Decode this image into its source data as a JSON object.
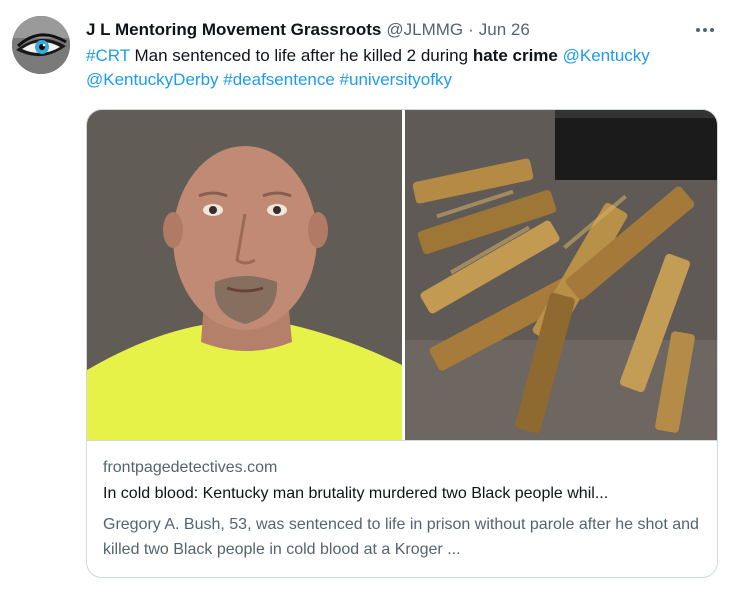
{
  "tweet": {
    "author": {
      "display_name": "J L Mentoring Movement Grassroots",
      "handle": "@JLMMG",
      "separator": "·",
      "date": "Jun 26"
    },
    "text": {
      "hashtag_crt": "#CRT",
      "body_part1": " Man sentenced to life after he killed 2 during ",
      "bold_phrase": "hate crime",
      "mention_kentucky": "@Kentucky",
      "mention_derby": "@KentuckyDerby",
      "hashtag_deaf": "#deafsentence",
      "hashtag_uky": "#universityofky"
    },
    "card": {
      "domain": "frontpagedetectives.com",
      "title": "In cold blood: Kentucky man brutality murdered two Black people whil...",
      "description": "Gregory A. Bush, 53, was sentenced to life in prison without parole after he shot and killed two Black people in cold blood at a Kroger ..."
    }
  },
  "icons": {
    "more": "more-horizontal-icon"
  },
  "colors": {
    "link": "#1d9bf0",
    "text": "#0f1419",
    "secondary": "#536471",
    "border": "#cfd9de",
    "shirt": "#e6f247",
    "mugshot_background": "#5d5751",
    "bullet_brass": "#b48a45"
  }
}
